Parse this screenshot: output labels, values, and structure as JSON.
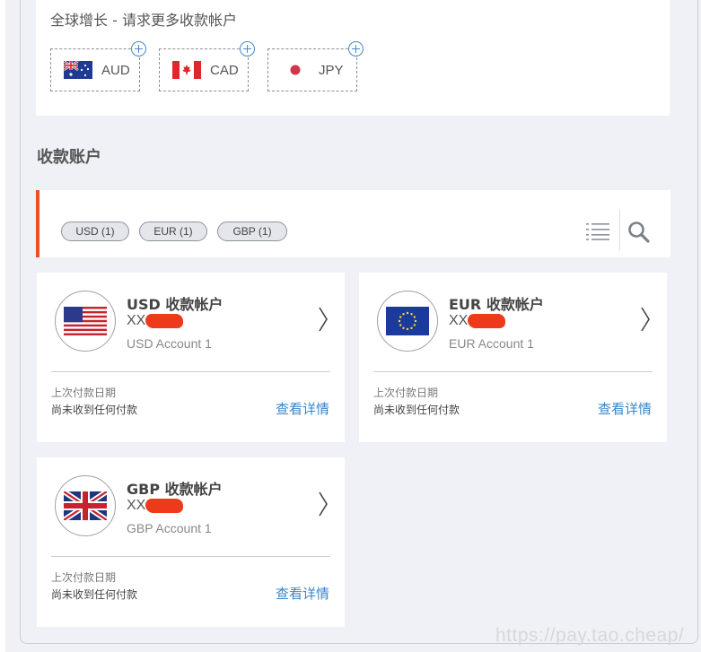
{
  "growth": {
    "title": "全球增长 - 请求更多收款帐户",
    "currencies": [
      {
        "code": "AUD",
        "flag": "australia-flag-icon"
      },
      {
        "code": "CAD",
        "flag": "canada-flag-icon"
      },
      {
        "code": "JPY",
        "flag": "japan-flag-icon"
      }
    ]
  },
  "section_title": "收款账户",
  "filters": [
    {
      "label": "USD (1)"
    },
    {
      "label": "EUR (1)"
    },
    {
      "label": "GBP (1)"
    }
  ],
  "accounts": [
    {
      "title": "USD 收款帐户",
      "number_prefix": "XX-",
      "name": "USD Account 1",
      "last_payment_label": "上次付款日期",
      "last_payment_value": "尚未收到任何付款",
      "details_label": "查看详情",
      "flag": "us-flag-icon"
    },
    {
      "title": "EUR 收款帐户",
      "number_prefix": "XX-",
      "name": "EUR Account 1",
      "last_payment_label": "上次付款日期",
      "last_payment_value": "尚未收到任何付款",
      "details_label": "查看详情",
      "flag": "eu-flag-icon"
    },
    {
      "title": "GBP 收款帐户",
      "number_prefix": "XX-",
      "name": "GBP Account 1",
      "last_payment_label": "上次付款日期",
      "last_payment_value": "尚未收到任何付款",
      "details_label": "查看详情",
      "flag": "uk-flag-icon"
    }
  ],
  "icons": {
    "list": "list-view-icon",
    "search": "search-icon",
    "add": "plus-circle-icon",
    "chevron": "chevron-right-icon"
  },
  "colors": {
    "accent": "#e8501f",
    "link": "#3a86c8",
    "redaction": "#ee3a1a"
  },
  "watermark": "https://pay.tao.cheap/"
}
